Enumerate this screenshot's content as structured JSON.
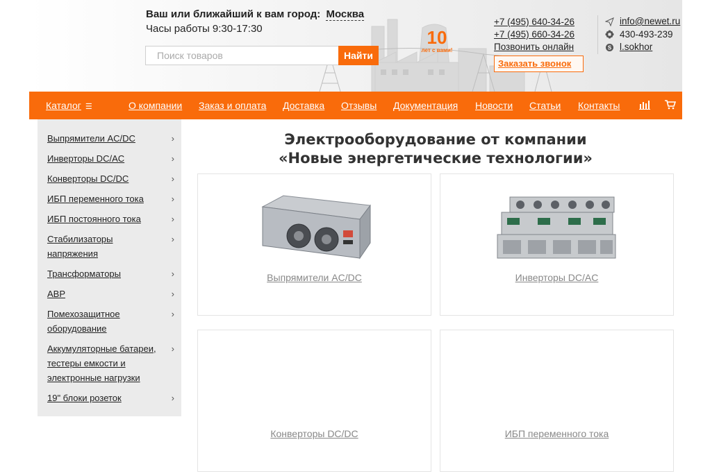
{
  "header": {
    "city_prefix": "Ваш или ближайший к вам город:",
    "city": "Москва",
    "hours": "Часы работы 9:30-17:30",
    "search_placeholder": "Поиск товаров",
    "search_button": "Найти",
    "anniversary_number": "10",
    "anniversary_text": "лет с вами!",
    "phones": [
      "+7 (495) 640-34-26",
      "+7 (495) 660-34-26"
    ],
    "call_online": "Позвонить онлайн",
    "callback_button": "Заказать звонок",
    "email": "info@newet.ru",
    "icq": "430-493-239",
    "skype": "l.sokhor"
  },
  "nav": {
    "catalog": "Каталог",
    "items": [
      "О компании",
      "Заказ и оплата",
      "Доставка",
      "Отзывы",
      "Документация",
      "Новости",
      "Статьи",
      "Контакты"
    ]
  },
  "sidebar": {
    "items": [
      "Выпрямители AC/DC",
      "Инверторы DC/AC",
      "Конверторы DC/DC",
      "ИБП переменного тока",
      "ИБП постоянного тока",
      "Стабилизаторы напряжения",
      "Трансформаторы",
      "АВР",
      "Помехозащитное оборудование",
      "Аккумуляторные батареи, тестеры емкости и электронные нагрузки",
      "19\" блоки розеток"
    ]
  },
  "main": {
    "title_line1": "Электрооборудование от компании",
    "title_line2": "«Новые энергетические технологии»",
    "cards": [
      "Выпрямители AC/DC",
      "Инверторы DC/AC",
      "Конверторы DC/DC",
      "ИБП переменного тока"
    ]
  },
  "colors": {
    "accent": "#f96b0b",
    "sidebar_bg": "#ebebeb"
  }
}
